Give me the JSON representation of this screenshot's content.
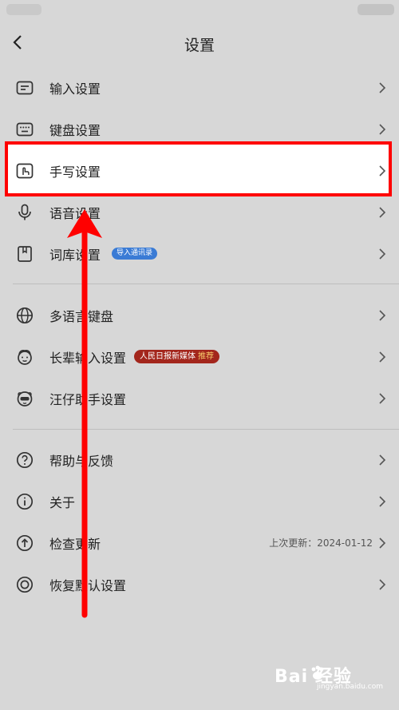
{
  "header": {
    "title": "设置"
  },
  "rows": [
    {
      "label": "输入设置",
      "icon": "input-settings-icon"
    },
    {
      "label": "键盘设置",
      "icon": "keyboard-icon"
    },
    {
      "label": "手写设置",
      "icon": "handwriting-icon"
    },
    {
      "label": "语音设置",
      "icon": "microphone-icon"
    },
    {
      "label": "词库设置",
      "icon": "dictionary-icon",
      "badge": "导入通讯录"
    },
    {
      "label": "多语言键盘",
      "icon": "globe-icon"
    },
    {
      "label": "长辈输入设置",
      "icon": "elder-face-icon",
      "badge": "人民日报新媒体",
      "badge_highlight": "推荐"
    },
    {
      "label": "汪仔助手设置",
      "icon": "assistant-face-icon"
    },
    {
      "label": "帮助与反馈",
      "icon": "help-icon"
    },
    {
      "label": "关于",
      "icon": "info-icon"
    },
    {
      "label": "检查更新",
      "icon": "update-icon",
      "right_text": "上次更新：2024-01-12"
    },
    {
      "label": "恢复默认设置",
      "icon": "reset-icon"
    }
  ],
  "watermark": {
    "main": "Bai  经验",
    "sub": "jingyan.baidu.com"
  },
  "colors": {
    "annotation": "#ff0000",
    "background": "#d7d7d7",
    "badge_blue": "#3a7bd5",
    "badge_red": "#a3261c"
  }
}
